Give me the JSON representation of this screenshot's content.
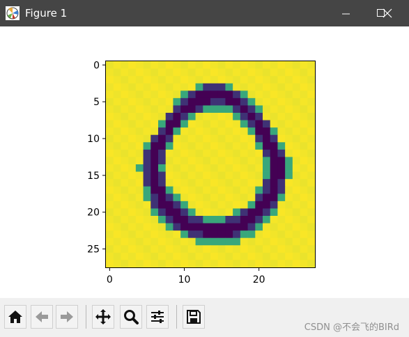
{
  "window": {
    "title": "Figure 1",
    "minimize_label": "minimize",
    "maximize_label": "maximize",
    "close_label": "close"
  },
  "figure": {
    "image_size": 28,
    "colormap": "viridis",
    "x_ticks": [
      "0",
      "10",
      "20"
    ],
    "y_ticks": [
      "0",
      "5",
      "10",
      "15",
      "20",
      "25"
    ],
    "digit": "0"
  },
  "toolbar": {
    "buttons": [
      {
        "name": "home",
        "tooltip": "Home"
      },
      {
        "name": "back",
        "tooltip": "Back"
      },
      {
        "name": "forward",
        "tooltip": "Forward"
      },
      {
        "name": "pan",
        "tooltip": "Pan"
      },
      {
        "name": "zoom",
        "tooltip": "Zoom"
      },
      {
        "name": "configure",
        "tooltip": "Configure subplots"
      },
      {
        "name": "save",
        "tooltip": "Save"
      }
    ]
  },
  "watermark": "CSDN @不会飞的BIRd",
  "colors": {
    "titlebar": "#454545",
    "toolbar": "#f0f0f0",
    "viridis_high": "#fde725",
    "viridis_low": "#440154"
  }
}
